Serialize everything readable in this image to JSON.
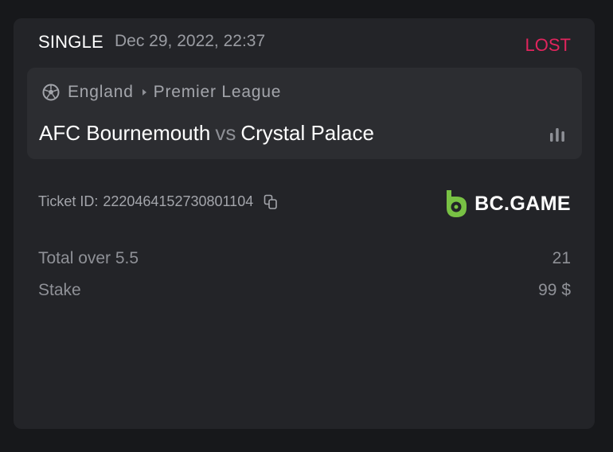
{
  "bet": {
    "type": "SINGLE",
    "date": "Dec 29, 2022, 22:37",
    "status": "LOST",
    "status_color": "#e1245d"
  },
  "match": {
    "sport_icon": "soccer-ball-icon",
    "country": "England",
    "league": "Premier League",
    "home_team": "AFC Bournemouth",
    "vs": "vs",
    "away_team": "Crystal Palace",
    "stats_icon": "bar-chart-icon"
  },
  "ticket": {
    "label": "Ticket ID:",
    "id": "2220464152730801104",
    "copy_icon": "copy-icon"
  },
  "brand": {
    "name": "BC.GAME",
    "logo_color": "#78c144"
  },
  "details": [
    {
      "label": "Total over 5.5",
      "value": "21"
    },
    {
      "label": "Stake",
      "value": "99 $"
    }
  ],
  "colors": {
    "background": "#17181b",
    "card": "#232428",
    "match_box": "#2c2d31"
  }
}
